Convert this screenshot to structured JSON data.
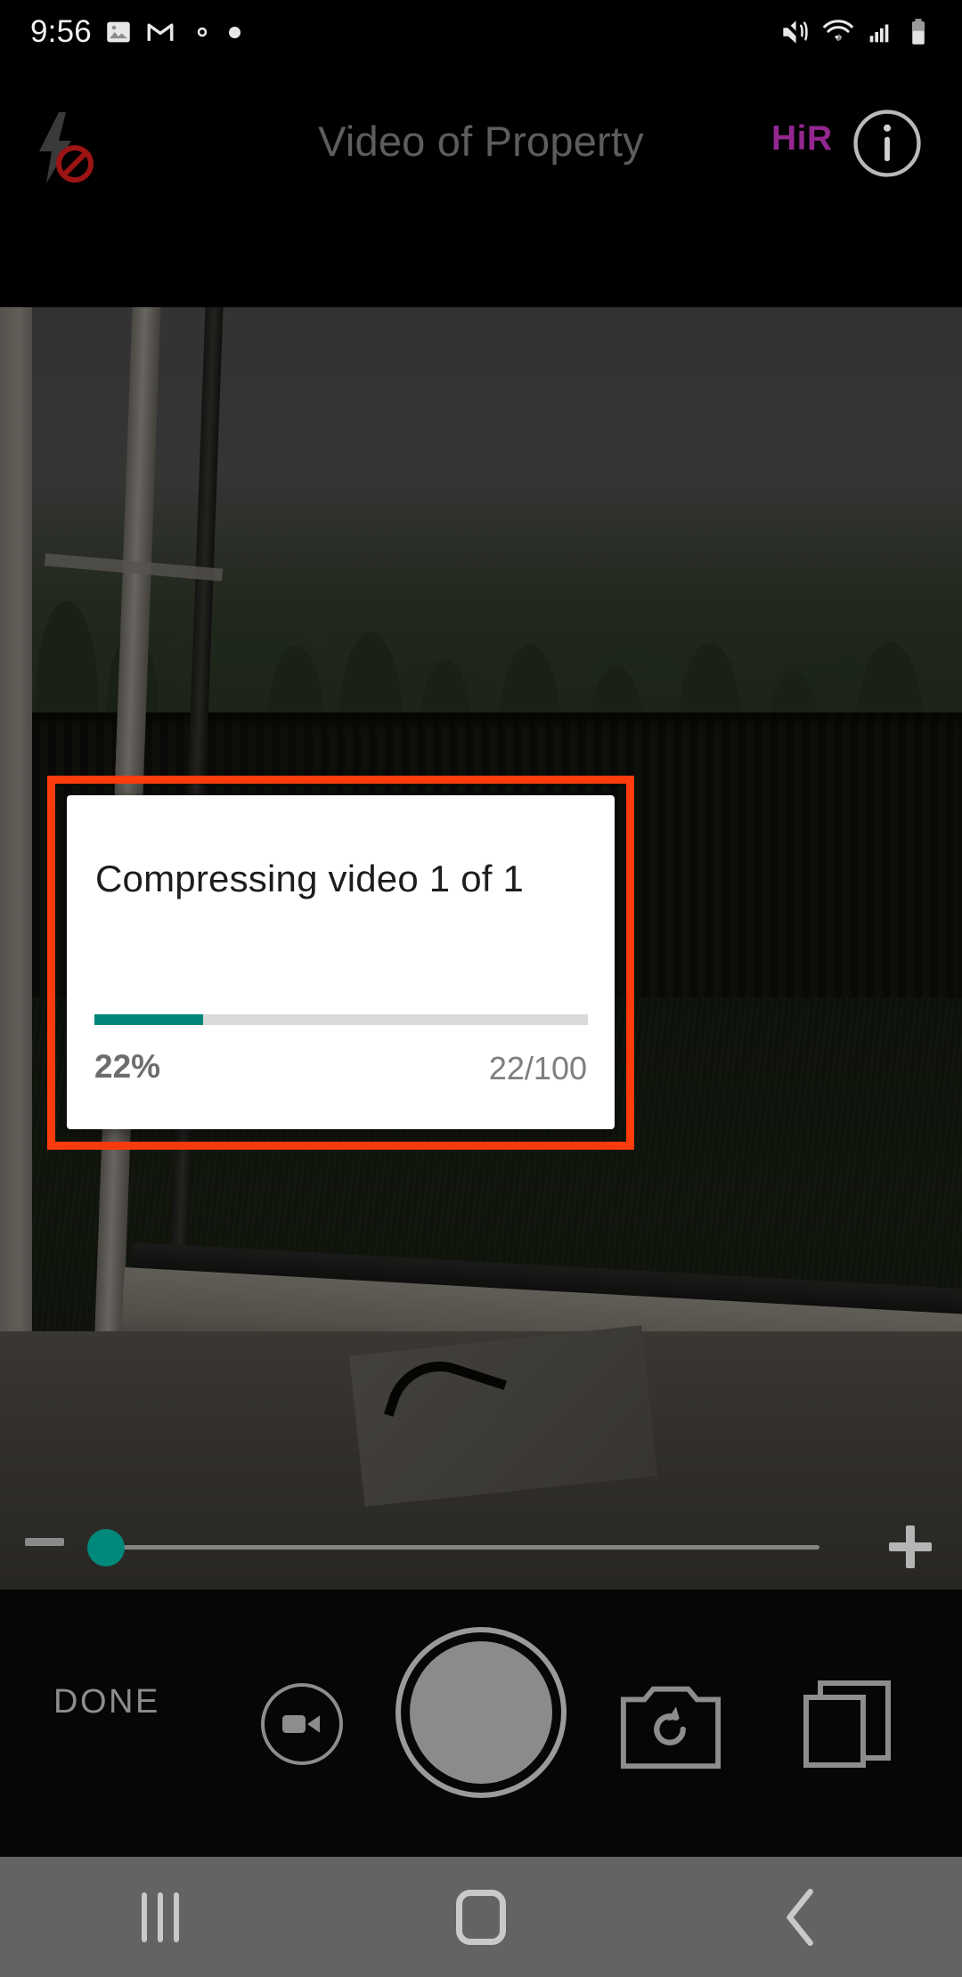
{
  "status_bar": {
    "time": "9:56",
    "left_icons": [
      "photos-icon",
      "gmail-icon",
      "settings-gear-icon",
      "dot-icon"
    ],
    "right_icons": [
      "vibrate-mute-icon",
      "wifi-icon",
      "cellular-signal-icon",
      "battery-icon"
    ]
  },
  "app_bar": {
    "title": "Video of Property",
    "flash_icon": "flash-off-icon",
    "hir_label": "HiR",
    "hir_color": "#93278f",
    "info_icon": "info-circle-icon"
  },
  "camera": {
    "zoom_slider": {
      "minus_label": "−",
      "plus_label": "+",
      "thumb_color": "#00897b",
      "value_fraction": 0.0
    },
    "toolbar": {
      "done_label": "DONE",
      "video_mode_icon": "video-camera-icon",
      "shutter_icon": "shutter-button",
      "flip_icon": "flip-camera-icon",
      "gallery_icon": "gallery-layers-icon"
    }
  },
  "dialog": {
    "message": "Compressing video 1 of 1",
    "percent_label": "22%",
    "count_label": "22/100",
    "progress_value": 22,
    "progress_max": 100,
    "fill_color": "#00857a",
    "track_color": "#dadada",
    "highlight_color": "#ff3c0d"
  },
  "nav_bar": {
    "recents_icon": "recents-icon",
    "home_icon": "home-icon",
    "back_icon": "back-chevron-icon",
    "background": "#636363"
  }
}
